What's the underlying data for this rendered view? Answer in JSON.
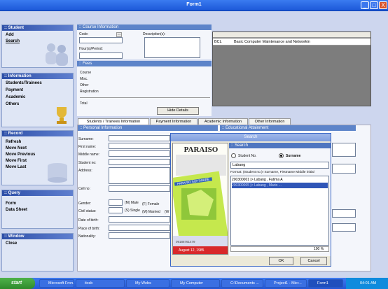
{
  "window": {
    "title": "Form1",
    "min": "_",
    "max": "□",
    "close": "X"
  },
  "sidebar": {
    "student": {
      "header": ":: Student",
      "items": [
        "Add",
        "Search"
      ]
    },
    "information": {
      "header": ":: Information",
      "items": [
        "Students/Trainees",
        "Payment",
        "Academic",
        "Others"
      ]
    },
    "record": {
      "header": ":: Record",
      "items": [
        "Refresh",
        "Move Next",
        "Move Previous",
        "Move First",
        "Move Last"
      ]
    },
    "query": {
      "header": ":: Query",
      "items": [
        "Form",
        "Data Sheet"
      ]
    },
    "window": {
      "header": ":: Window",
      "items": [
        "Close"
      ]
    }
  },
  "course": {
    "header": ":: Course Information",
    "code_label": "Code:",
    "description_label": "Description(s):",
    "hours_label": "Hour(s)/Period:",
    "grid_row": {
      "code": "BCL",
      "description": "Basic Computer Maintenance and Networkin"
    }
  },
  "fees": {
    "header": ":: Fees",
    "items": [
      "Course",
      "Misc.",
      "Other",
      "Registration"
    ],
    "total_label": "Total",
    "hide_button": "Hide Details"
  },
  "tabs": [
    "Students / Trainees Information",
    "Payment Information",
    "Academic Information",
    "Other Information"
  ],
  "personal": {
    "header": ":: Personal Information",
    "fields": [
      "Surname:",
      "First name:",
      "Middle name:",
      "Student no:",
      "Address:",
      "Cell no:",
      "Gender:",
      "Civil status:",
      "Date of birth:",
      "Place of birth:",
      "Nationality:"
    ],
    "gender_male": "(M) Male",
    "gender_female": "(F) Female",
    "civil_single": "(S) Single",
    "civil_married": "(M) Married",
    "civil_w": "(W"
  },
  "education": {
    "header": ":: Educational Attainment"
  },
  "search": {
    "title": "Search",
    "header": ":: Search",
    "logo_text": "PARAISO",
    "logo_sub": "PARAISO SOFTWARE",
    "splash_phone": "09186761479",
    "splash_date": "August 12, 1985",
    "option_student_no": "Student No.",
    "option_surname": "Surname",
    "input_value": "Labang",
    "format_text": "Format: (Student no.)r Surname, Firstname Middle initial",
    "results": [
      "200300001 |> Labang , Fatima  A",
      "200300005 |> Labang , Mario  ..."
    ],
    "zoom": "100 %",
    "ok_button": "OK",
    "cancel_button": "Cancel"
  },
  "taskbar": {
    "start": "start",
    "tasks": [
      "Microsoft Fron...",
      "itcsb",
      "My Webs",
      "My Computer",
      "C:\\Documents ...",
      "Project1 - Micr...",
      "Form1"
    ],
    "clock": "04:01 AM"
  },
  "colors": {
    "accent": "#5d84c9",
    "sidebar_head": "#2d4fa8",
    "title_bar": "#1c58d8",
    "start_green": "#2f8a2b"
  }
}
